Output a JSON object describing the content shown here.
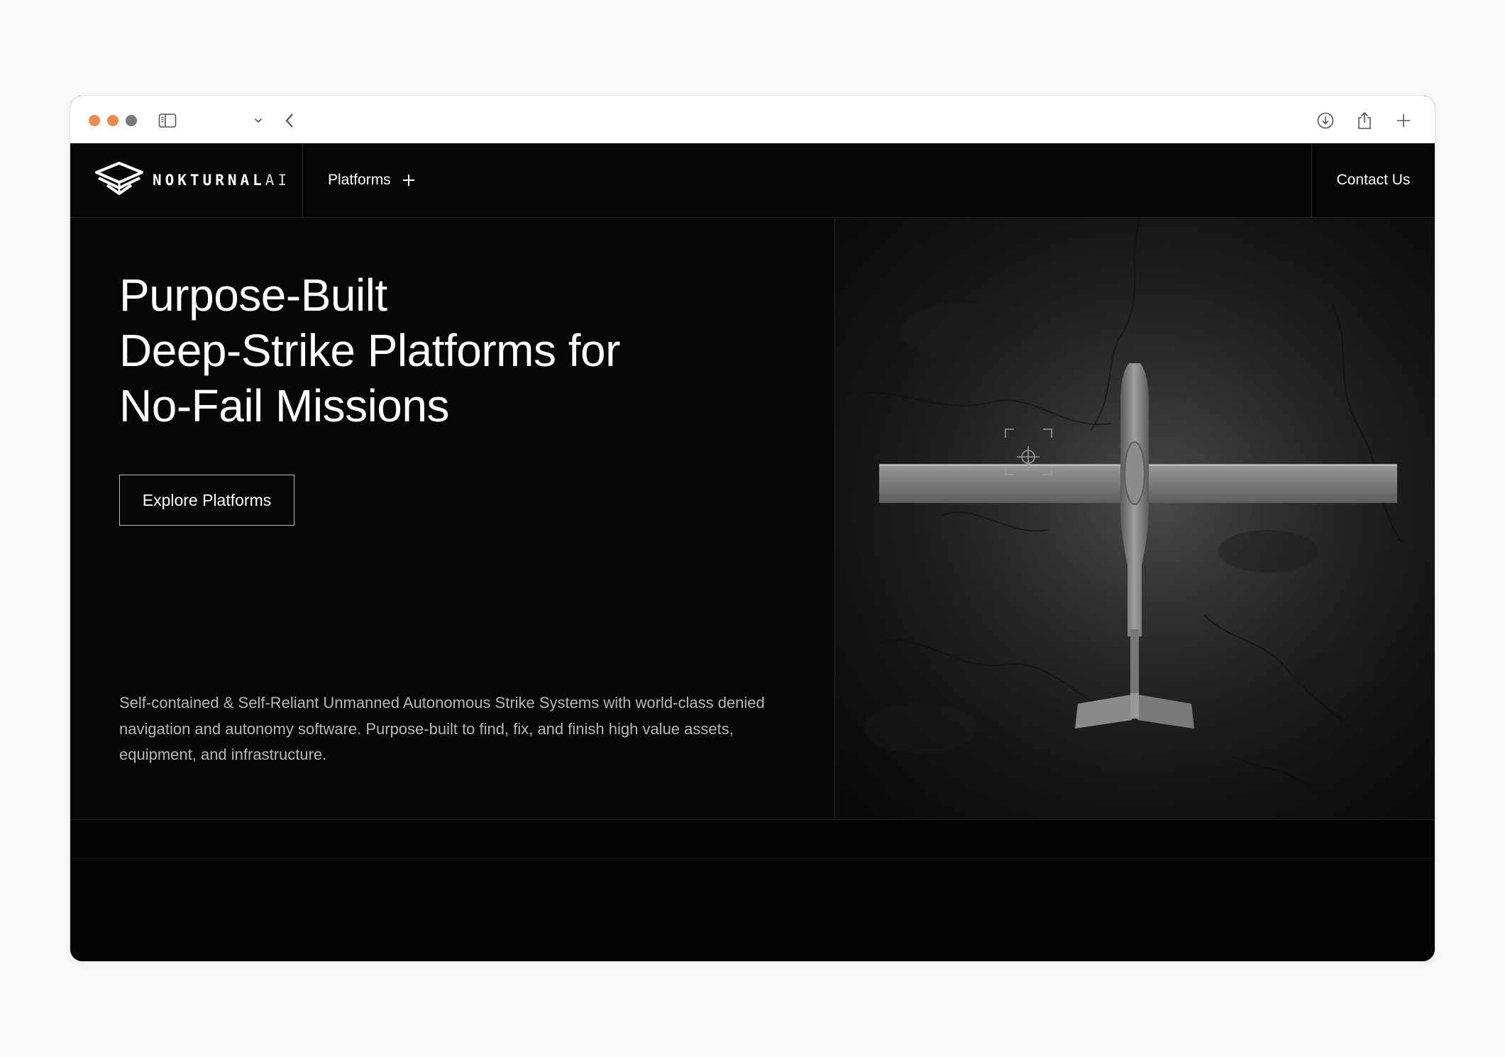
{
  "browser": {
    "traffic_lights": [
      "#ee8a4e",
      "#ee8a4e",
      "#7a7a7a"
    ],
    "icons": [
      "sidebar-icon",
      "chevron-down-icon",
      "back-arrow-icon",
      "download-icon",
      "share-icon",
      "new-tab-plus-icon"
    ]
  },
  "nav": {
    "brand_main": "NOKTURNAL",
    "brand_suffix": "AI",
    "platforms_label": "Platforms",
    "contact_label": "Contact Us"
  },
  "hero": {
    "title_lines": [
      "Purpose-Built",
      "Deep-Strike Platforms for",
      "No-Fail Missions"
    ],
    "cta_label": "Explore Platforms",
    "description": "Self-contained & Self-Reliant Unmanned Autonomous Strike Systems with world-class denied navigation and autonomy software. Purpose-built to find, fix, and finish high value assets, equipment, and infrastructure."
  },
  "colors": {
    "background": "#060606",
    "text": "#ffffff",
    "muted_text": "#b7b7b7",
    "page": "#faf9f7"
  }
}
